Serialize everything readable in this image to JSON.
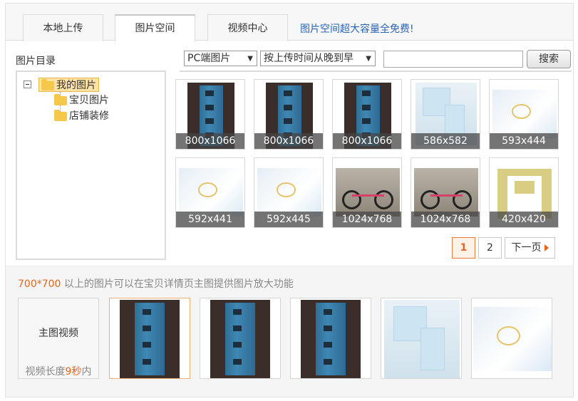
{
  "tabs": [
    {
      "label": "本地上传",
      "active": false
    },
    {
      "label": "图片空间",
      "active": true
    },
    {
      "label": "视频中心",
      "active": false
    }
  ],
  "promo": "图片空间超大容量全免费!",
  "sidebar": {
    "title": "图片目录",
    "tree": {
      "root": "我的图片",
      "children": [
        "宝贝图片",
        "店铺装修"
      ]
    }
  },
  "toolbar": {
    "source_select": "PC端图片",
    "sort_select": "按上传时间从晚到早",
    "search_value": "",
    "search_button": "搜索"
  },
  "images": [
    {
      "size": "800x1066",
      "kind": "ram"
    },
    {
      "size": "800x1066",
      "kind": "ram"
    },
    {
      "size": "800x1066",
      "kind": "ram"
    },
    {
      "size": "586x582",
      "kind": "baby"
    },
    {
      "size": "593x444",
      "kind": "fabric"
    },
    {
      "size": "592x441",
      "kind": "fabric"
    },
    {
      "size": "592x445",
      "kind": "fabric"
    },
    {
      "size": "1024x768",
      "kind": "bike"
    },
    {
      "size": "1024x768",
      "kind": "bike"
    },
    {
      "size": "420x420",
      "kind": "blocks"
    }
  ],
  "pagination": {
    "current": "1",
    "page2": "2",
    "next": "下一页"
  },
  "bottom": {
    "tip_highlight": "700*700",
    "tip_text": " 以上的图片可以在宝贝详情页主图提供图片放大功能",
    "video_title": "主图视频",
    "video_note_prefix": "视频长度",
    "video_note_highlight": "9秒",
    "video_note_suffix": "内"
  },
  "main_images": [
    "ram",
    "ram",
    "ram",
    "baby",
    "fabric"
  ]
}
